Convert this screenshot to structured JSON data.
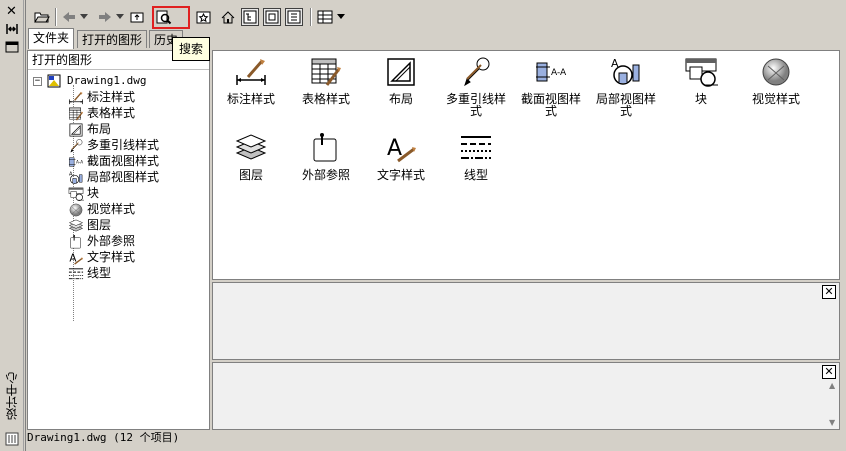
{
  "palette_title": "设计中心",
  "toolbar": {
    "tooltip": "搜索"
  },
  "tabs": [
    {
      "label": "文件夹"
    },
    {
      "label": "打开的图形"
    },
    {
      "label": "历史"
    }
  ],
  "tree": {
    "header": "打开的图形",
    "root": "Drawing1.dwg",
    "items": [
      {
        "label": "标注样式",
        "icon": "dimstyle-icon"
      },
      {
        "label": "表格样式",
        "icon": "tablestyle-icon"
      },
      {
        "label": "布局",
        "icon": "layout-icon"
      },
      {
        "label": "多重引线样式",
        "icon": "mleaderstyle-icon"
      },
      {
        "label": "截面视图样式",
        "icon": "sectionview-icon"
      },
      {
        "label": "局部视图样式",
        "icon": "detailview-icon"
      },
      {
        "label": "块",
        "icon": "block-icon"
      },
      {
        "label": "视觉样式",
        "icon": "visualstyle-icon"
      },
      {
        "label": "图层",
        "icon": "layer-icon"
      },
      {
        "label": "外部参照",
        "icon": "xref-icon"
      },
      {
        "label": "文字样式",
        "icon": "textstyle-icon"
      },
      {
        "label": "线型",
        "icon": "linetype-icon"
      }
    ]
  },
  "content": {
    "items": [
      {
        "label": "标注样式"
      },
      {
        "label": "表格样式"
      },
      {
        "label": "布局"
      },
      {
        "label": "多重引线样式"
      },
      {
        "label": "截面视图样式"
      },
      {
        "label": "局部视图样式"
      },
      {
        "label": "块"
      },
      {
        "label": "视觉样式"
      },
      {
        "label": "图层"
      },
      {
        "label": "外部参照"
      },
      {
        "label": "文字样式"
      },
      {
        "label": "线型"
      }
    ]
  },
  "status": "Drawing1.dwg (12 个项目)"
}
